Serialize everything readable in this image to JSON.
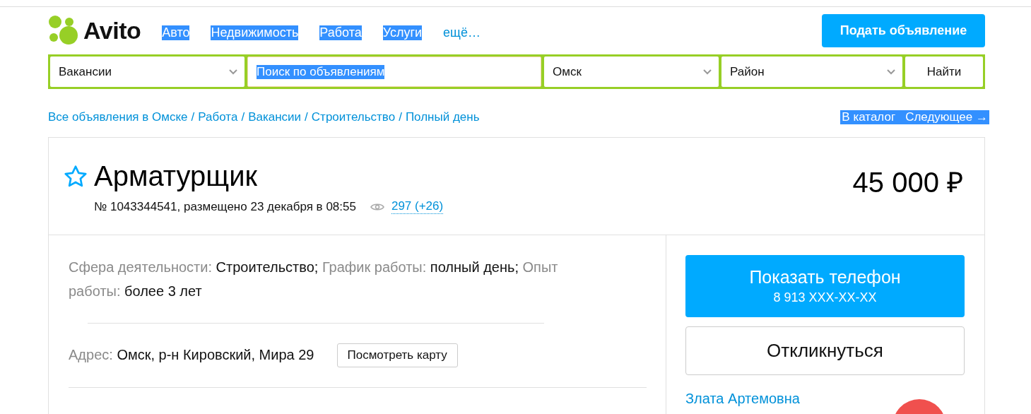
{
  "header": {
    "logo": "Avito",
    "nav": [
      {
        "label": "Авто",
        "highlighted": true
      },
      {
        "label": "Недвижимость",
        "highlighted": true
      },
      {
        "label": "Работа",
        "highlighted": true
      },
      {
        "label": "Услуги",
        "highlighted": true
      },
      {
        "label": "ещё…",
        "highlighted": false
      }
    ],
    "post_button": "Подать объявление"
  },
  "search": {
    "category": "Вакансии",
    "query": {
      "value": "Поиск по объявлениям",
      "highlighted": true
    },
    "city": "Омск",
    "district": "Район",
    "submit": "Найти"
  },
  "breadcrumbs": [
    {
      "label": "Все объявления в Омске"
    },
    {
      "separator": "/",
      "label": "Работа"
    },
    {
      "separator": "/",
      "label": "Вакансии"
    },
    {
      "separator": "/",
      "label": "Строительство"
    },
    {
      "separator": "/",
      "label": "Полный день"
    }
  ],
  "breadcrumb_actions": {
    "highlighted": true,
    "items": [
      "В каталог",
      "Следующее →"
    ]
  },
  "listing": {
    "favorite": false,
    "title": "Арматурщик",
    "price": "45 000 ₽",
    "meta": "№ 1043344541, размещено 23 декабря в 08:55",
    "views": "297 (+26)",
    "details": [
      {
        "label": "Сфера деятельности:",
        "value": "Строительство;"
      },
      {
        "label": "График работы:",
        "value": "полный день;"
      },
      {
        "label": "Опыт работы:",
        "value": "более 3 лет"
      }
    ],
    "address_label": "Адрес:",
    "address": "Омск, р-н Кировский, Мира 29",
    "map_button": "Посмотреть карту"
  },
  "contact": {
    "phone_button": "Показать телефон",
    "phone": "8 913 XXX-XX-XX",
    "respond_button": "Откликнуться",
    "seller": "Злата Артемовна"
  }
}
